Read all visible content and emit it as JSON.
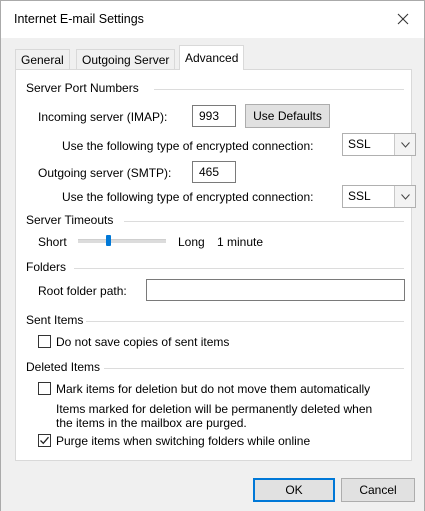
{
  "window": {
    "title": "Internet E-mail Settings"
  },
  "tabs": [
    {
      "label": "General",
      "active": false
    },
    {
      "label": "Outgoing Server",
      "active": false
    },
    {
      "label": "Advanced",
      "active": true
    }
  ],
  "server_ports": {
    "group_label": "Server Port Numbers",
    "incoming_label": "Incoming server (IMAP):",
    "incoming_value": "993",
    "use_defaults_label": "Use Defaults",
    "incoming_encryption_label": "Use the following type of encrypted connection:",
    "incoming_encryption_value": "SSL",
    "outgoing_label": "Outgoing server (SMTP):",
    "outgoing_value": "465",
    "outgoing_encryption_label": "Use the following type of encrypted connection:",
    "outgoing_encryption_value": "SSL"
  },
  "timeouts": {
    "group_label": "Server Timeouts",
    "short_label": "Short",
    "long_label": "Long",
    "value_label": "1 minute",
    "slider_fraction": 0.1,
    "accent_color": "#0078d7"
  },
  "folders": {
    "group_label": "Folders",
    "root_label": "Root folder path:",
    "root_value": ""
  },
  "sent_items": {
    "group_label": "Sent Items",
    "no_copies_label": "Do not save copies of sent items",
    "no_copies_checked": false
  },
  "deleted_items": {
    "group_label": "Deleted Items",
    "mark_label": "Mark items for deletion but do not move them automatically",
    "mark_checked": false,
    "note_line1": "Items marked for deletion will be permanently deleted when",
    "note_line2": "the items in the mailbox are purged.",
    "purge_label": "Purge items when switching folders while online",
    "purge_checked": true
  },
  "buttons": {
    "ok_label": "OK",
    "cancel_label": "Cancel"
  }
}
